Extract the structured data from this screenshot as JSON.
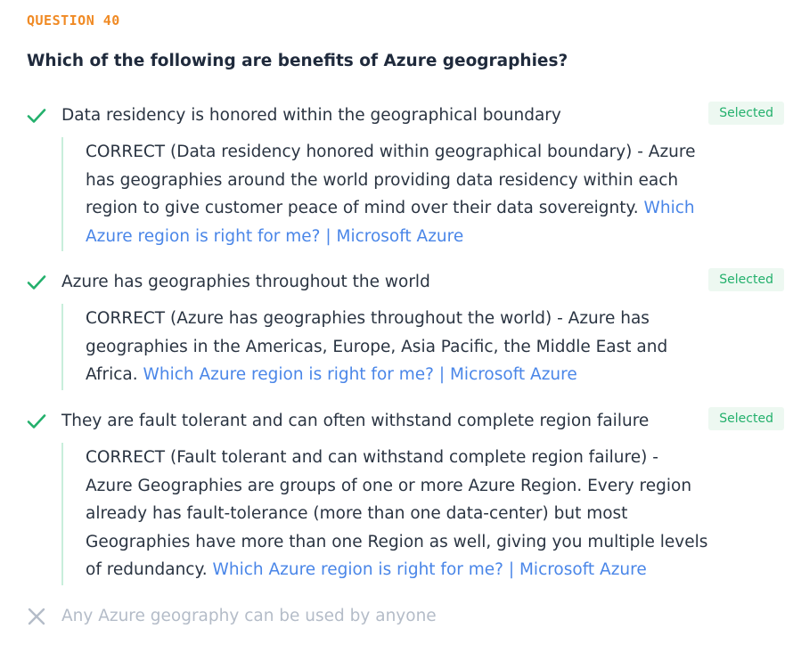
{
  "question": {
    "label": "QUESTION 40",
    "title": "Which of the following are benefits of Azure geographies?"
  },
  "options": [
    {
      "text": "Data residency is honored within the geographical boundary",
      "status": "correct",
      "badge": "Selected",
      "explanation": "CORRECT (Data residency honored within geographical boundary) - Azure has geographies around the world providing data residency within each region to give customer peace of mind over their data sovereignty.",
      "link": "Which Azure region is right for me? | Microsoft Azure"
    },
    {
      "text": "Azure has geographies throughout the world",
      "status": "correct",
      "badge": "Selected",
      "explanation": "CORRECT (Azure has geographies throughout the world) - Azure has geographies in the Americas, Europe, Asia Pacific, the Middle East and Africa.",
      "link": "Which Azure region is right for me? | Microsoft Azure"
    },
    {
      "text": "They are fault tolerant and can often withstand complete region failure",
      "status": "correct",
      "badge": "Selected",
      "explanation": "CORRECT (Fault tolerant and can withstand complete region failure) - Azure Geographies are groups of one or more Azure Region. Every region already has fault-tolerance (more than one data-center) but most Geographies have more than one Region as well, giving you multiple levels of redundancy.",
      "link": "Which Azure region is right for me? | Microsoft Azure"
    },
    {
      "text": "Any Azure geography can be used by anyone",
      "status": "incorrect"
    }
  ],
  "icons": {
    "correct": "checkmark-icon",
    "incorrect": "x-mark-icon"
  },
  "colors": {
    "accent_orange": "#f08a24",
    "correct_green": "#23b06c",
    "link_blue": "#4a86e8",
    "muted_gray": "#b4bcc8"
  }
}
